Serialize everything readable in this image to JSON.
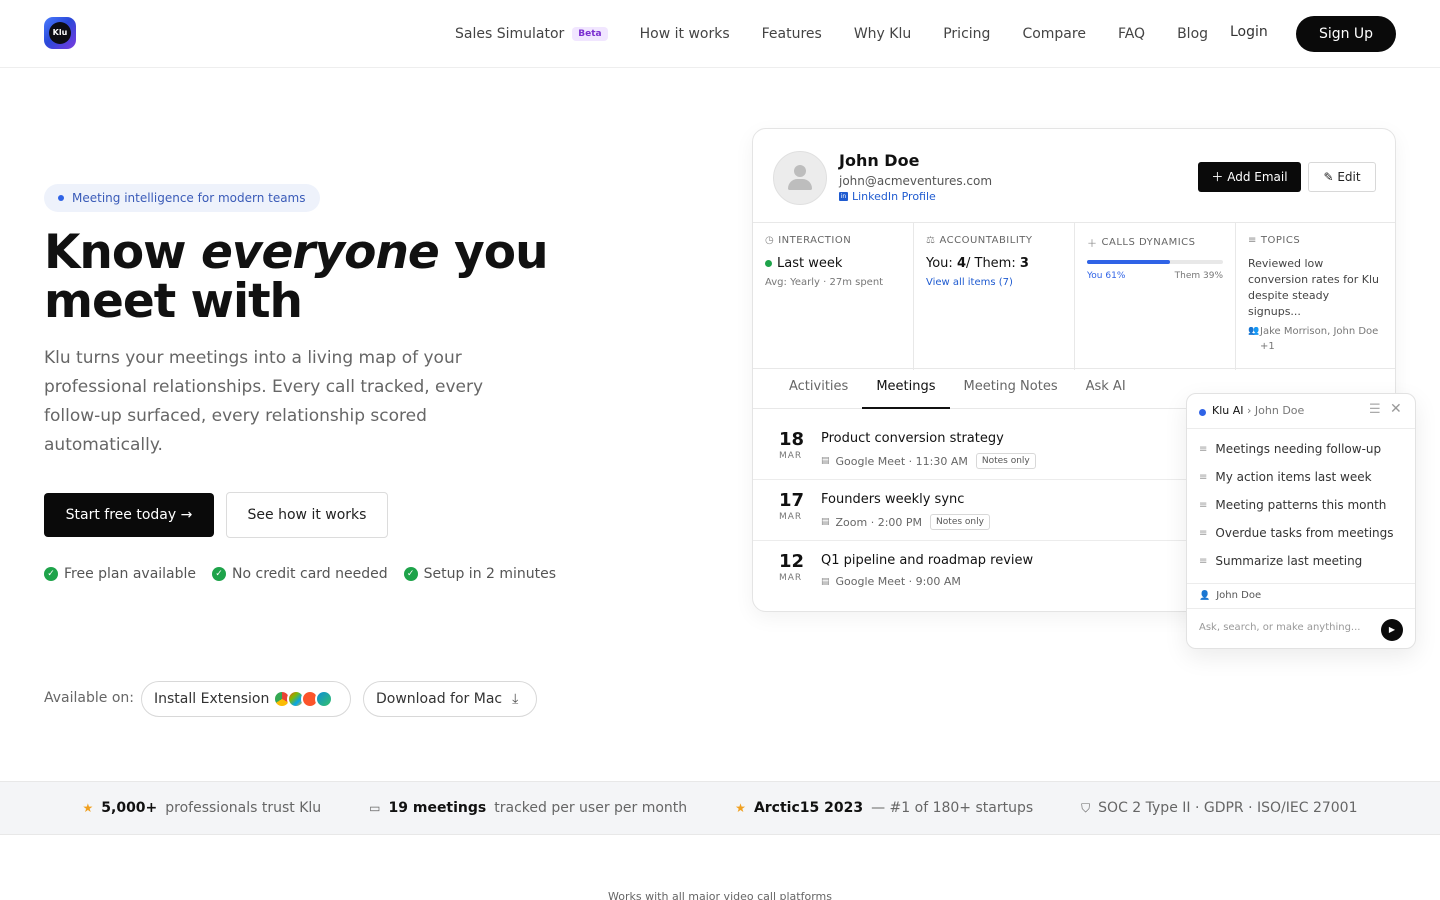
{
  "nav": {
    "logo_text": "Klu",
    "links": [
      "Sales Simulator",
      "How it works",
      "Features",
      "Why Klu",
      "Pricing",
      "Compare",
      "FAQ",
      "Blog"
    ],
    "beta_badge": "Beta",
    "login": "Login",
    "signup": "Sign Up"
  },
  "hero": {
    "pill": "Meeting intelligence for modern teams",
    "headline_part1": "Know ",
    "headline_em": "everyone",
    "headline_part2": " you meet with",
    "subtext": "Klu turns your meetings into a living map of your professional relationships. Every call tracked, every follow-up surfaced, every relationship scored automatically.",
    "cta_primary": "Start free today →",
    "cta_secondary": "See how it works",
    "checks": [
      "Free plan available",
      "No credit card needed",
      "Setup in 2 minutes"
    ],
    "available_label": "Available on:",
    "install_extension": "Install Extension",
    "download_mac": "Download for Mac"
  },
  "card": {
    "name": "John Doe",
    "email": "john@acmeventures.com",
    "linkedin": "LinkedIn Profile",
    "add_email": "Add Email",
    "edit": "Edit",
    "stats": {
      "interaction": {
        "header": "INTERACTION",
        "main": "Last week",
        "small": "Avg: Yearly · 27m spent"
      },
      "accountability": {
        "header": "ACCOUNTABILITY",
        "you_label": "You: ",
        "you_value": "4",
        "sep": " / Them: ",
        "them_value": "3",
        "link": "View all items (7)"
      },
      "calls": {
        "header": "CALLS DYNAMICS",
        "you_label": "You 61%",
        "them_label": "Them 39%",
        "you_fraction": 0.61
      },
      "topics": {
        "header": "TOPICS",
        "text": "Reviewed low conversion rates for Klu despite steady signups...",
        "people": "Jake Morrison, John Doe +1"
      }
    },
    "tabs": [
      "Activities",
      "Meetings",
      "Meeting Notes",
      "Ask AI"
    ],
    "active_tab": 1,
    "meetings": [
      {
        "day": "18",
        "month": "MAR",
        "title": "Product conversion strategy",
        "meta": "Google Meet · 11:30 AM",
        "badge": "Notes only"
      },
      {
        "day": "17",
        "month": "MAR",
        "title": "Founders weekly sync",
        "meta": "Zoom · 2:00 PM",
        "badge": "Notes only"
      },
      {
        "day": "12",
        "month": "MAR",
        "title": "Q1 pipeline and roadmap review",
        "meta": "Google Meet · 9:00 AM",
        "badge": ""
      }
    ]
  },
  "klu_ai": {
    "title": "Klu AI",
    "context": "› John Doe",
    "items": [
      "Meetings needing follow-up",
      "My action items last week",
      "Meeting patterns this month",
      "Overdue tasks from meetings",
      "Summarize last meeting"
    ],
    "user": "John Doe",
    "placeholder": "Ask, search, or make anything..."
  },
  "trust": {
    "item1_bold": "5,000+",
    "item1_text": "professionals trust Klu",
    "item2_bold": "19 meetings",
    "item2_text": "tracked per user per month",
    "item3_bold": "Arctic15 2023",
    "item3_text": "— #1 of 180+ startups",
    "item4_text": "SOC 2 Type II · GDPR · ISO/IEC 27001"
  },
  "works_with": "Works with all major video call platforms",
  "colors": {
    "accent": "#2f63e6",
    "success": "#1ea34a",
    "beta": "#7b2fd0",
    "star": "#f0a020"
  }
}
